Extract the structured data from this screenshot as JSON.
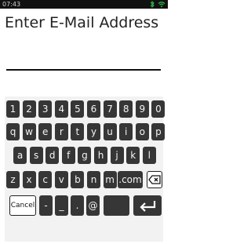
{
  "statusbar": {
    "time": "07:43"
  },
  "prompt": {
    "title": "Enter E-Mail Address"
  },
  "keyboard": {
    "row1": [
      "1",
      "2",
      "3",
      "4",
      "5",
      "6",
      "7",
      "8",
      "9",
      "0"
    ],
    "row2": [
      "q",
      "w",
      "e",
      "r",
      "t",
      "y",
      "u",
      "i",
      "o",
      "p"
    ],
    "row3": [
      "a",
      "s",
      "d",
      "f",
      "g",
      "h",
      "j",
      "k",
      "l"
    ],
    "row4": [
      "z",
      "x",
      "c",
      "v",
      "b",
      "n",
      "m"
    ],
    "dotcom": ".com",
    "cancel": "Cancel",
    "minus": "-",
    "underscore": "_",
    "dot": ".",
    "at": "@",
    "icons": {
      "backspace": "backspace-icon",
      "enter": "enter-icon"
    }
  }
}
